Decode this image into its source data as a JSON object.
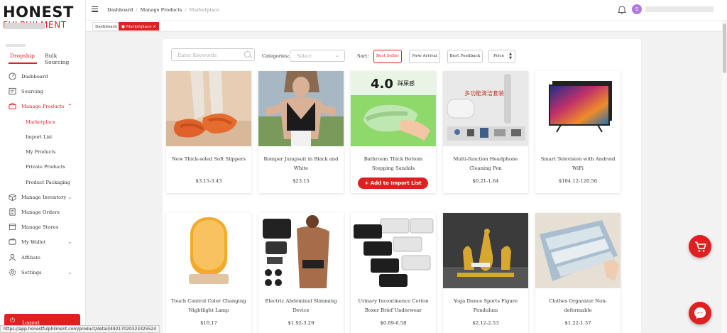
{
  "brand": {
    "line1": "HONEST",
    "line2": "FULPHILMENT"
  },
  "sidebar": {
    "tabs": [
      "Dropship",
      "Bulk Sourcing"
    ],
    "items": [
      {
        "label": "Dashboard",
        "icon": "dashboard-icon"
      },
      {
        "label": "Sourcing",
        "icon": "sourcing-icon"
      },
      {
        "label": "Manage Products",
        "icon": "box-icon"
      },
      {
        "label": "Manage Inventory",
        "icon": "inventory-icon"
      },
      {
        "label": "Manage Orders",
        "icon": "orders-icon"
      },
      {
        "label": "Manage Stores",
        "icon": "store-icon"
      },
      {
        "label": "My Wallet",
        "icon": "wallet-icon"
      },
      {
        "label": "Affiliate",
        "icon": "affiliate-icon"
      },
      {
        "label": "Settings",
        "icon": "gear-icon"
      }
    ],
    "subitems": [
      "Marketplace",
      "Import List",
      "My Products",
      "Private Products",
      "Product Packaging"
    ],
    "logout": "Logout"
  },
  "header": {
    "breadcrumb": [
      "Dashboard",
      "Manage Products",
      "Marketplace"
    ],
    "avatar_letter": "S"
  },
  "page_tabs": [
    {
      "label": "Dashboard"
    },
    {
      "label": "Marketplace",
      "close": "×"
    }
  ],
  "filters": {
    "search_placeholder": "Enter Keywords",
    "categories_label": "Categories:",
    "categories_placeholder": "Select",
    "sort_label": "Sort:",
    "sort_options": [
      "Best Seller",
      "New Arrival",
      "Best Feedback",
      "Price"
    ]
  },
  "products": [
    {
      "name": "New Thick-soled Soft Slippers",
      "price": "$3.15-3.43"
    },
    {
      "name": "Romper Jumpsuit in Black and White",
      "price": "$23.15"
    },
    {
      "name": "Bathroom Thick Bottom Stepping Sandals",
      "price": "",
      "action": "+ Add to Import List",
      "image_text": "4.0",
      "image_subtext": "踩屎感"
    },
    {
      "name": "Multi-function Headphone Cleaning Pen",
      "price": "$0.21-1.64",
      "image_text": "多功能清洁套装"
    },
    {
      "name": "Smart Television with Android WiFi",
      "price": "$104.12-120.56"
    },
    {
      "name": "Touch Control Color Changing Nightlight Lamp",
      "price": "$10.17"
    },
    {
      "name": "Electric Abdominal Slimming Device",
      "price": "$1.92-3.29"
    },
    {
      "name": "Urinary Incontinence Cotton Boxer Brief Underwear",
      "price": "$0.69-6.58"
    },
    {
      "name": "Yoga Dance Sports Figure Pendulum",
      "price": "$2.12-2.53"
    },
    {
      "name": "Clothes Organizer Non-deformable",
      "price": "$1.22-1.37"
    }
  ],
  "status_url": "https://app.honestfulphilment.com/product/detail/49217020323325524",
  "colors": {
    "accent": "#e02020"
  }
}
